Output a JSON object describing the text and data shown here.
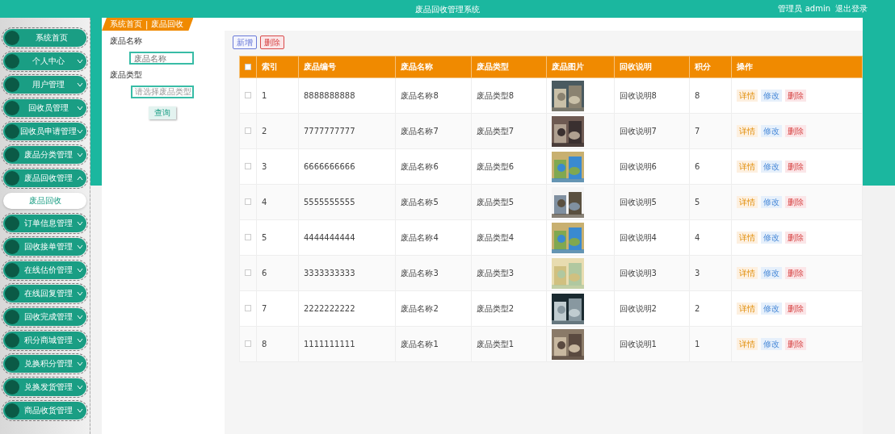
{
  "header": {
    "title": "废品回收管理系统",
    "user": "管理员 admin",
    "logout": "退出登录"
  },
  "sidebar": {
    "items": [
      {
        "label": "系统首页",
        "has_arrow": false
      },
      {
        "label": "个人中心",
        "expanded": false,
        "has_arrow": true
      },
      {
        "label": "用户管理",
        "expanded": false,
        "has_arrow": true
      },
      {
        "label": "回收员管理",
        "expanded": false,
        "has_arrow": true
      },
      {
        "label": "回收员申请管理",
        "expanded": false,
        "has_arrow": true
      },
      {
        "label": "废品分类管理",
        "expanded": false,
        "has_arrow": true
      },
      {
        "label": "废品回收管理",
        "expanded": true,
        "has_arrow": true,
        "children": [
          {
            "label": "废品回收",
            "selected": true
          }
        ]
      },
      {
        "label": "订单信息管理",
        "expanded": false,
        "has_arrow": true
      },
      {
        "label": "回收接单管理",
        "expanded": false,
        "has_arrow": true
      },
      {
        "label": "在线估价管理",
        "expanded": false,
        "has_arrow": true
      },
      {
        "label": "在线回复管理",
        "expanded": false,
        "has_arrow": true
      },
      {
        "label": "回收完成管理",
        "expanded": false,
        "has_arrow": true
      },
      {
        "label": "积分商城管理",
        "expanded": false,
        "has_arrow": true
      },
      {
        "label": "兑换积分管理",
        "expanded": false,
        "has_arrow": true
      },
      {
        "label": "兑换发货管理",
        "expanded": false,
        "has_arrow": true
      },
      {
        "label": "商品收货管理",
        "expanded": false,
        "has_arrow": true
      }
    ]
  },
  "breadcrumb": {
    "items": [
      "系统首页",
      "废品回收"
    ],
    "separator": "|"
  },
  "search": {
    "fields": [
      {
        "label": "废品名称",
        "kind": "input",
        "placeholder": "废品名称"
      },
      {
        "label": "废品类型",
        "kind": "select",
        "placeholder": "请选择废品类型"
      }
    ],
    "button": "查询"
  },
  "toolbar": {
    "add": "新增",
    "delete": "删除"
  },
  "table": {
    "select_all_checked": false,
    "columns": [
      "索引",
      "废品编号",
      "废品名称",
      "废品类型",
      "废品图片",
      "回收说明",
      "积分",
      "操作"
    ],
    "rows": [
      {
        "checked": false,
        "index": "1",
        "code": "8888888888",
        "name": "废品名称8",
        "type": "废品类型8",
        "note": "回收说明8",
        "points": "8",
        "actions": [
          "详情",
          "修改",
          "删除"
        ]
      },
      {
        "checked": false,
        "index": "2",
        "code": "7777777777",
        "name": "废品名称7",
        "type": "废品类型7",
        "note": "回收说明7",
        "points": "7",
        "actions": [
          "详情",
          "修改",
          "删除"
        ]
      },
      {
        "checked": false,
        "index": "3",
        "code": "6666666666",
        "name": "废品名称6",
        "type": "废品类型6",
        "note": "回收说明6",
        "points": "6",
        "actions": [
          "详情",
          "修改",
          "删除"
        ]
      },
      {
        "checked": false,
        "index": "4",
        "code": "5555555555",
        "name": "废品名称5",
        "type": "废品类型5",
        "note": "回收说明5",
        "points": "5",
        "actions": [
          "详情",
          "修改",
          "删除"
        ]
      },
      {
        "checked": false,
        "index": "5",
        "code": "4444444444",
        "name": "废品名称4",
        "type": "废品类型4",
        "note": "回收说明4",
        "points": "4",
        "actions": [
          "详情",
          "修改",
          "删除"
        ]
      },
      {
        "checked": false,
        "index": "6",
        "code": "3333333333",
        "name": "废品名称3",
        "type": "废品类型3",
        "note": "回收说明3",
        "points": "3",
        "actions": [
          "详情",
          "修改",
          "删除"
        ]
      },
      {
        "checked": false,
        "index": "7",
        "code": "2222222222",
        "name": "废品名称2",
        "type": "废品类型2",
        "note": "回收说明2",
        "points": "2",
        "actions": [
          "详情",
          "修改",
          "删除"
        ]
      },
      {
        "checked": false,
        "index": "8",
        "code": "1111111111",
        "name": "废品名称1",
        "type": "废品类型1",
        "note": "回收说明1",
        "points": "1",
        "actions": [
          "详情",
          "修改",
          "删除"
        ]
      }
    ]
  }
}
